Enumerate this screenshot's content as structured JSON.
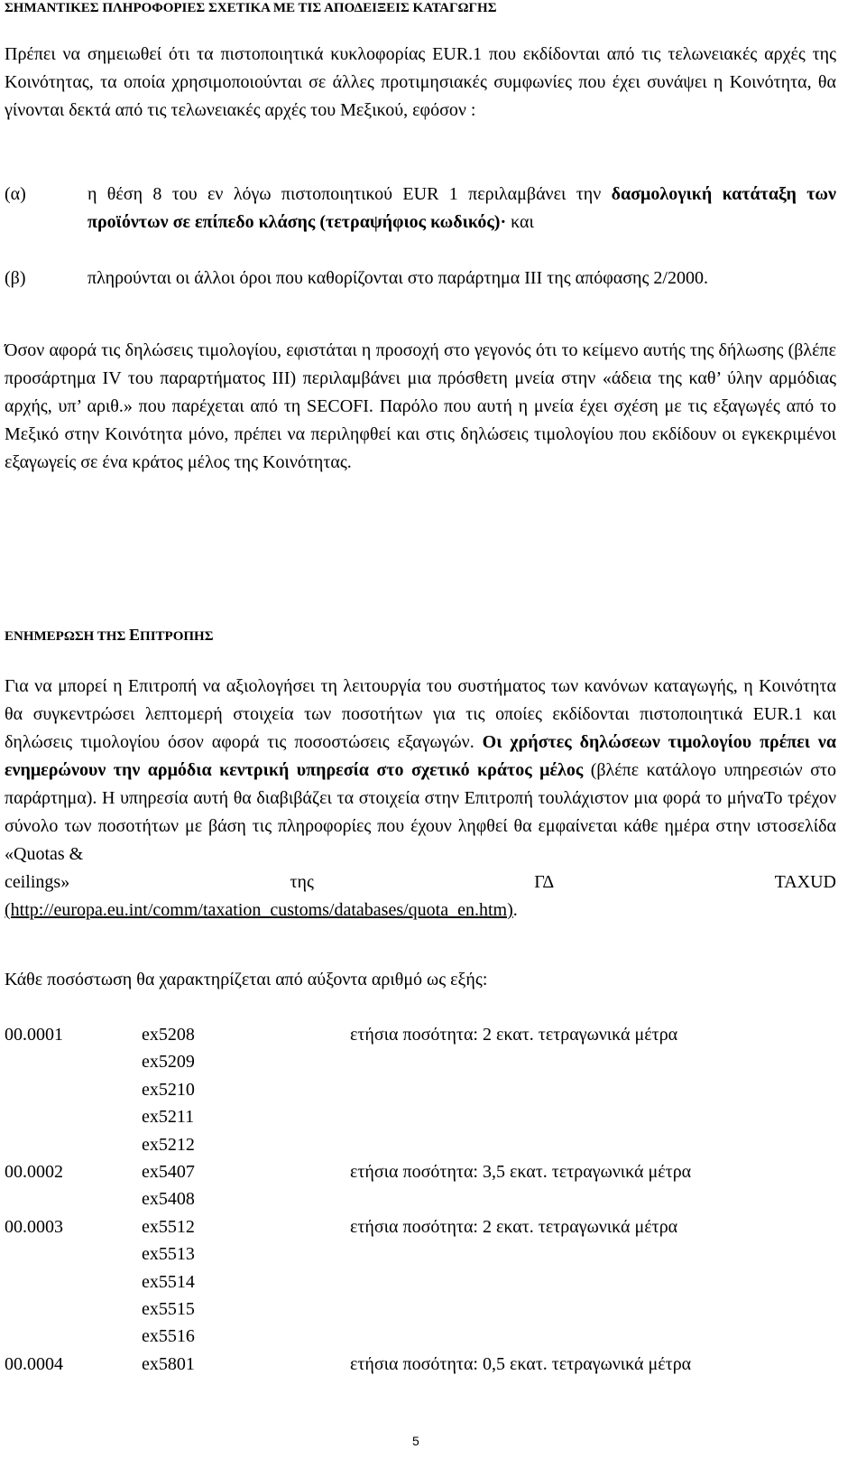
{
  "heading_origin": "ΣΗΜΑΝΤΙΚΕΣ ΠΛΗΡΟΦΟΡΙΕΣ ΣΧΕΤΙΚΑ ΜΕ ΤΙΣ ΑΠΟΔΕΙΞΕΙΣ ΚΑΤΑΓΩΓΗΣ",
  "para1": "Πρέπει να σημειωθεί ότι τα πιστοποιητικά κυκλοφορίας EUR.1 που εκδίδονται από τις τελωνειακές αρχές της Κοινότητας, τα οποία χρησιμοποιούνται σε άλλες προτιμησιακές συμφωνίες που έχει συνάψει η Κοινότητα, θα γίνονται δεκτά από τις τελωνειακές αρχές του Μεξικού, εφόσον :",
  "item_a": {
    "label": "(α)",
    "text_pre": "η θέση 8 του εν λόγω πιστοποιητικού EUR 1 περιλαμβάνει την ",
    "text_bold": "δασμολογική κατάταξη των προϊόντων σε επίπεδο κλάσης (τετραψήφιος κωδικός)·",
    "text_post": " και"
  },
  "item_b": {
    "label": "(β)",
    "text": "πληρούνται οι άλλοι όροι που καθορίζονται στο παράρτημα III της απόφασης 2/2000."
  },
  "para2": "Όσον αφορά τις δηλώσεις τιμολογίου, εφιστάται η προσοχή στο γεγονός ότι το κείμενο αυτής της δήλωσης (βλέπε προσάρτημα IV του παραρτήματος III) περιλαμβάνει μια πρόσθετη μνεία στην «άδεια της καθ’ ύλην αρμόδιας αρχής, υπ’ αριθ.» που παρέχεται από τη SECOFI. Παρόλο που αυτή η μνεία έχει σχέση με τις εξαγωγές από το Μεξικό στην Κοινότητα μόνο, πρέπει να περιληφθεί και στις δηλώσεις τιμολογίου που εκδίδουν οι εγκεκριμένοι εξαγωγείς σε ένα κράτος μέλος της Κοινότητας.",
  "heading_commission": {
    "part1": "ΕΝΗΜΕΡΩΣΗ ΤΗΣ ",
    "big_letter": "Ε",
    "part2": "ΠΙΤΡΟΠΗΣ"
  },
  "para3": {
    "text1": "Για να μπορεί η Επιτροπή να αξιολογήσει τη λειτουργία του συστήματος των κανόνων καταγωγής, η Κοινότητα θα συγκεντρώσει λεπτομερή στοιχεία των ποσοτήτων για τις οποίες εκδίδονται πιστοποιητικά EUR.1 και δηλώσεις τιμολογίου όσον αφορά τις ποσοστώσεις εξαγωγών. ",
    "bold": "Οι χρήστες δηλώσεων τιμολογίου πρέπει να ενημερώνουν την αρμόδια κεντρική υπηρεσία στο σχετικό κράτος μέλος",
    "text2": " (βλέπε κατάλογο υπηρεσιών στο παράρτημα). Η υπηρεσία αυτή θα διαβιβάζει τα στοιχεία στην Επιτροπή τουλάχιστον μια φορά το μήναΤο τρέχον σύνολο των ποσοτήτων με βάση τις πληροφορίες που έχουν ληφθεί θα εμφαίνεται κάθε ημέρα στην ιστοσελίδα «Quotas &",
    "tail_words": [
      "ceilings»",
      "της",
      "ΓΔ",
      "TAXUD"
    ],
    "url": "(http://europa.eu.int/comm/taxation_customs/databases/quota_en.htm)",
    "end": "."
  },
  "para4": "Κάθε ποσόστωση θα χαρακτηρίζεται από αύξοντα αριθμό ως εξής:",
  "quotas": [
    {
      "code": "00.0001",
      "numbers": [
        "ex5208",
        "ex5209",
        "ex5210",
        "ex5211",
        "ex5212"
      ],
      "desc": "ετήσια ποσότητα: 2 εκατ. τετραγωνικά μέτρα"
    },
    {
      "code": "00.0002",
      "numbers": [
        "ex5407",
        "ex5408"
      ],
      "desc": "ετήσια ποσότητα: 3,5 εκατ. τετραγωνικά μέτρα"
    },
    {
      "code": "00.0003",
      "numbers": [
        "ex5512",
        "ex5513",
        "ex5514",
        "ex5515",
        "ex5516"
      ],
      "desc": "ετήσια ποσότητα: 2 εκατ. τετραγωνικά μέτρα"
    },
    {
      "code": "00.0004",
      "numbers": [
        "ex5801"
      ],
      "desc": "ετήσια ποσότητα: 0,5 εκατ. τετραγωνικά μέτρα"
    }
  ],
  "page_number": "5"
}
